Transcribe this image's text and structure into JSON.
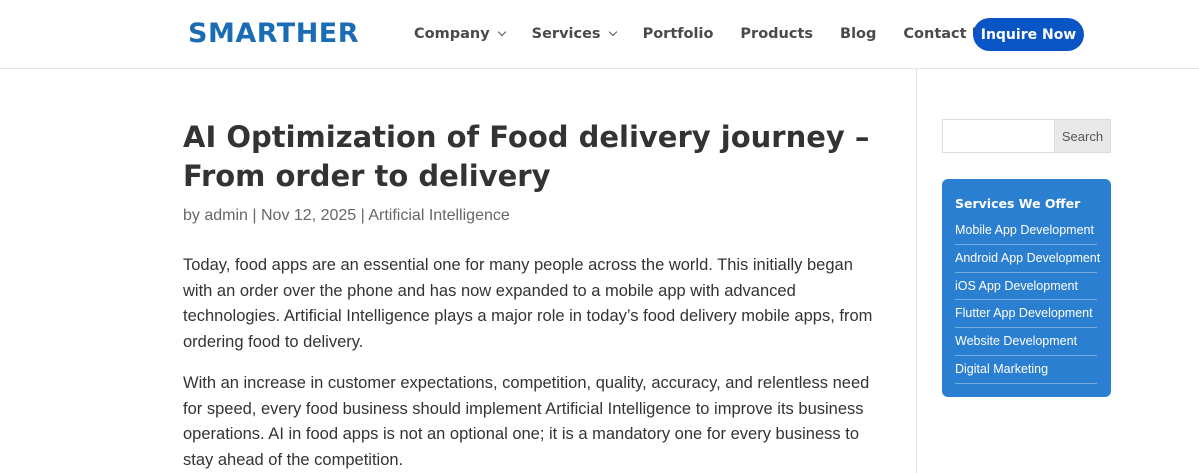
{
  "header": {
    "logo_text": "SMARTHER",
    "nav": [
      {
        "label": "Company",
        "has_dropdown": true
      },
      {
        "label": "Services",
        "has_dropdown": true
      },
      {
        "label": "Portfolio",
        "has_dropdown": false
      },
      {
        "label": "Products",
        "has_dropdown": false
      },
      {
        "label": "Blog",
        "has_dropdown": false
      },
      {
        "label": "Contact Us",
        "has_dropdown": false
      }
    ],
    "cta_label": "Inquire Now"
  },
  "article": {
    "title": "AI Optimization of Food delivery journey – From order to delivery",
    "meta": {
      "prefix": "by",
      "author": "admin",
      "separator": "|",
      "date": "Nov 12, 2025",
      "category": "Artificial Intelligence"
    },
    "paragraphs": [
      "Today, food apps are an essential one for many people across the world.  This initially began with an order over the phone and has now expanded to a mobile app with advanced technologies.  Artificial Intelligence plays a major role in today’s food delivery mobile apps, from ordering food to delivery.",
      "With an increase in customer expectations, competition, quality, accuracy, and relentless need for speed, every food business should implement Artificial Intelligence to improve its business operations. AI in food apps is not an optional one; it is a mandatory one for every business to stay ahead of the competition."
    ]
  },
  "sidebar": {
    "search": {
      "value": "",
      "button_label": "Search"
    },
    "services": {
      "title": "Services We Offer",
      "items": [
        "Mobile App Development",
        "Android App Development",
        "iOS App Development",
        "Flutter App Development",
        "Website Development",
        "Digital Marketing"
      ]
    }
  },
  "colors": {
    "brand": "#1a6db5",
    "cta": "#0a55c5",
    "services_box": "#2b7fd0"
  }
}
